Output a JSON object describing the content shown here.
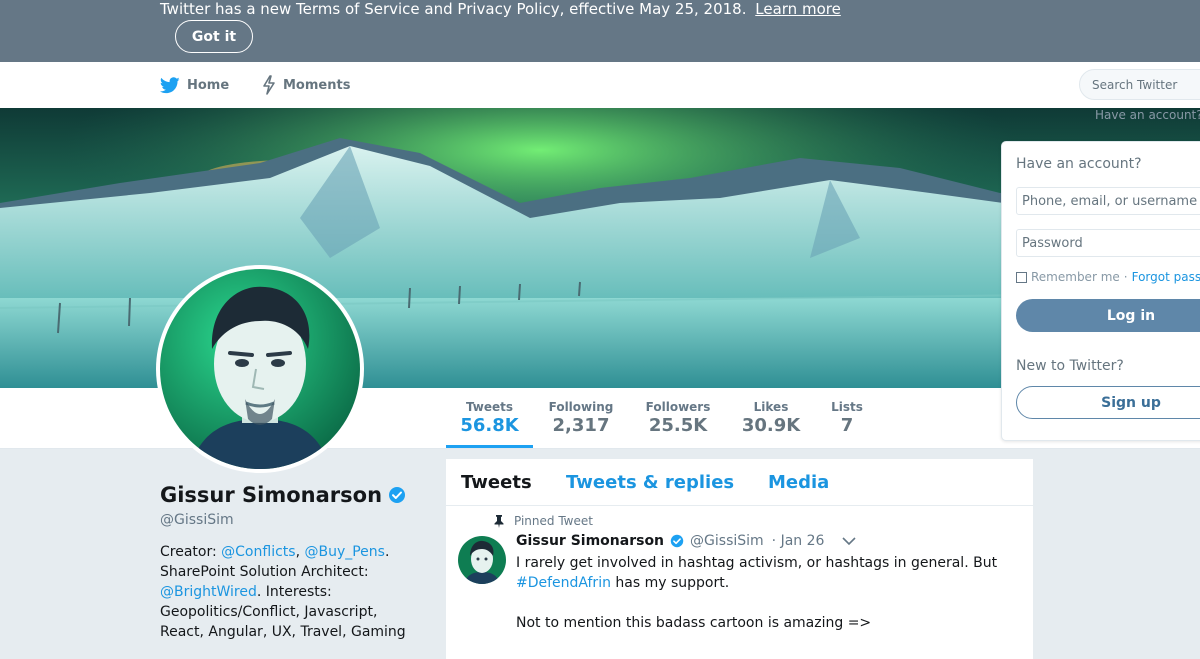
{
  "banner": {
    "text": "Twitter has a new Terms of Service and Privacy Policy, effective May 25, 2018.",
    "link": "Learn more",
    "button": "Got it"
  },
  "nav": {
    "home": "Home",
    "moments": "Moments",
    "search_placeholder": "Search Twitter"
  },
  "cover_hint": "Have an account?",
  "stats": [
    {
      "label": "Tweets",
      "value": "56.8K"
    },
    {
      "label": "Following",
      "value": "2,317"
    },
    {
      "label": "Followers",
      "value": "25.5K"
    },
    {
      "label": "Likes",
      "value": "30.9K"
    },
    {
      "label": "Lists",
      "value": "7"
    }
  ],
  "profile": {
    "name": "Gissur Simonarson",
    "handle": "@GissiSim",
    "bio_prefix": "Creator: ",
    "bio_link1": "@Conflicts",
    "bio_sep": ", ",
    "bio_link2": "@Buy_Pens",
    "bio_mid": ". SharePoint Solution Architect: ",
    "bio_link3": "@BrightWired",
    "bio_suffix": ". Interests: Geopolitics/Conflict, Javascript, React, Angular, UX, Travel, Gaming"
  },
  "tabs": [
    "Tweets",
    "Tweets & replies",
    "Media"
  ],
  "tweet": {
    "pinned_label": "Pinned Tweet",
    "name": "Gissur Simonarson",
    "handle": "@GissiSim",
    "time": "· Jan 26",
    "text_part1": "I rarely get involved in hashtag activism, or hashtags in general. But ",
    "hashtag": "#DefendAfrin",
    "text_part2": " has my support.",
    "text_line3": "Not to mention this badass cartoon is amazing =>"
  },
  "login": {
    "title": "Have an account?",
    "username_placeholder": "Phone, email, or username",
    "password_placeholder": "Password",
    "remember": "Remember me",
    "forgot": "Forgot password?",
    "login_button": "Log in",
    "new_title": "New to Twitter?",
    "signup_button": "Sign up"
  },
  "colors": {
    "banner_bg": "#657786",
    "accent": "#1da1f2",
    "link": "#1b95e0",
    "login_button": "#5f87a9"
  },
  "icons": {
    "logo": "twitter-bird-icon",
    "moments": "lightning-icon",
    "verified": "verified-badge-icon",
    "pin": "pin-icon",
    "caret": "chevron-down-icon"
  }
}
